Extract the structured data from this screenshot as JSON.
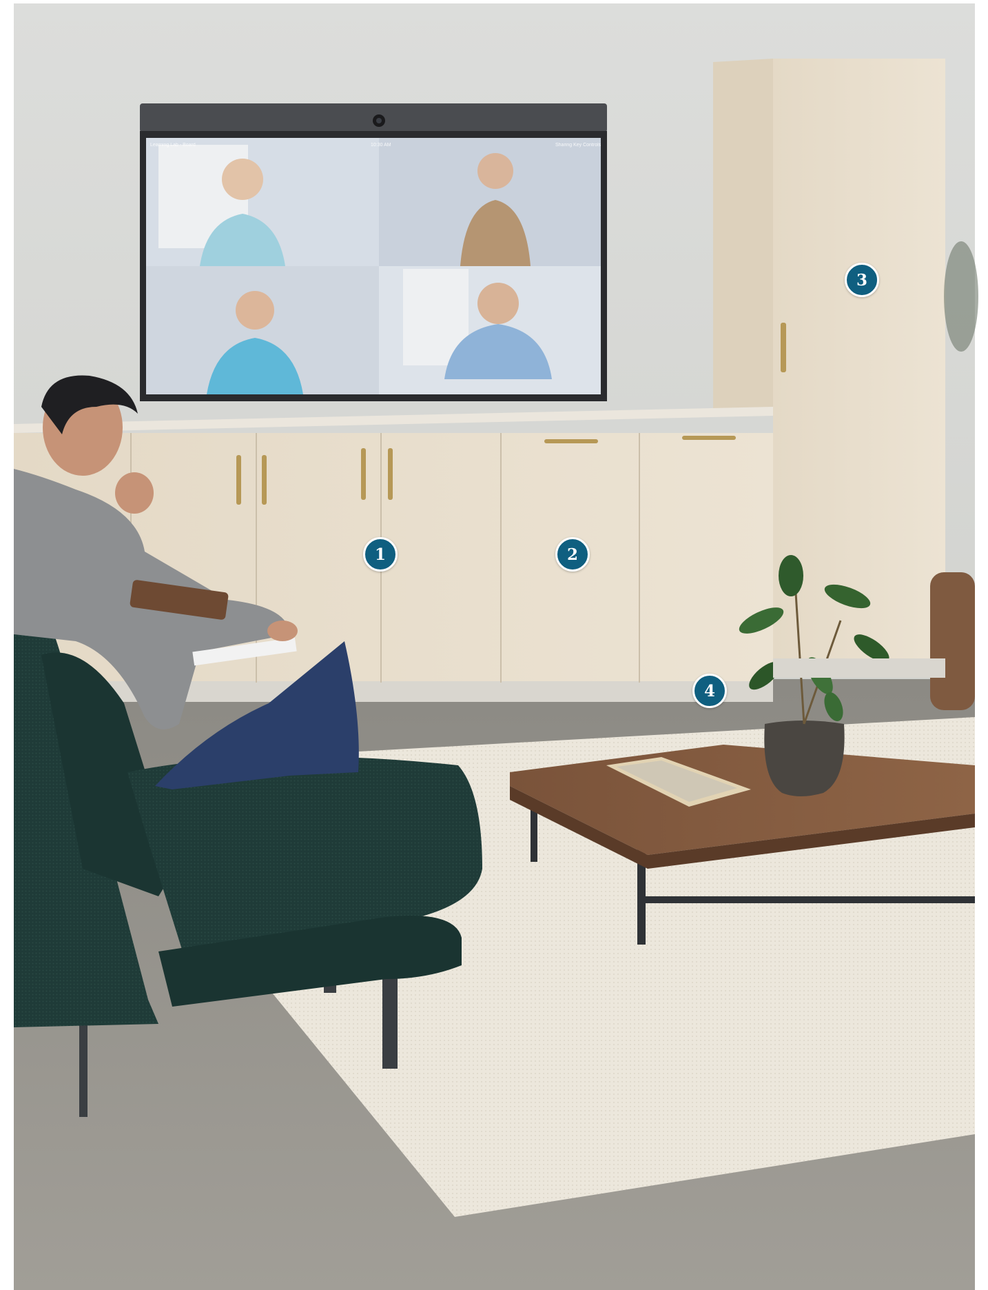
{
  "image": {
    "description_free": true
  },
  "display": {
    "top_left_text": "Learning Lab - Board",
    "top_center_text": "10:30 AM",
    "top_right_text": "Sharing Key Controls"
  },
  "callouts": [
    {
      "id": "1",
      "label": "1"
    },
    {
      "id": "2",
      "label": "2"
    },
    {
      "id": "3",
      "label": "3"
    },
    {
      "id": "4",
      "label": "4"
    }
  ],
  "colors": {
    "callout_fill": "#0f5f80",
    "callout_border": "#ffffff",
    "wall": "#d9dad6",
    "cabinet": "#e6dccb",
    "floor": "#9c9890",
    "rug": "#ebe6da",
    "sofa": "#1e3a37",
    "table": "#6e4a33"
  }
}
